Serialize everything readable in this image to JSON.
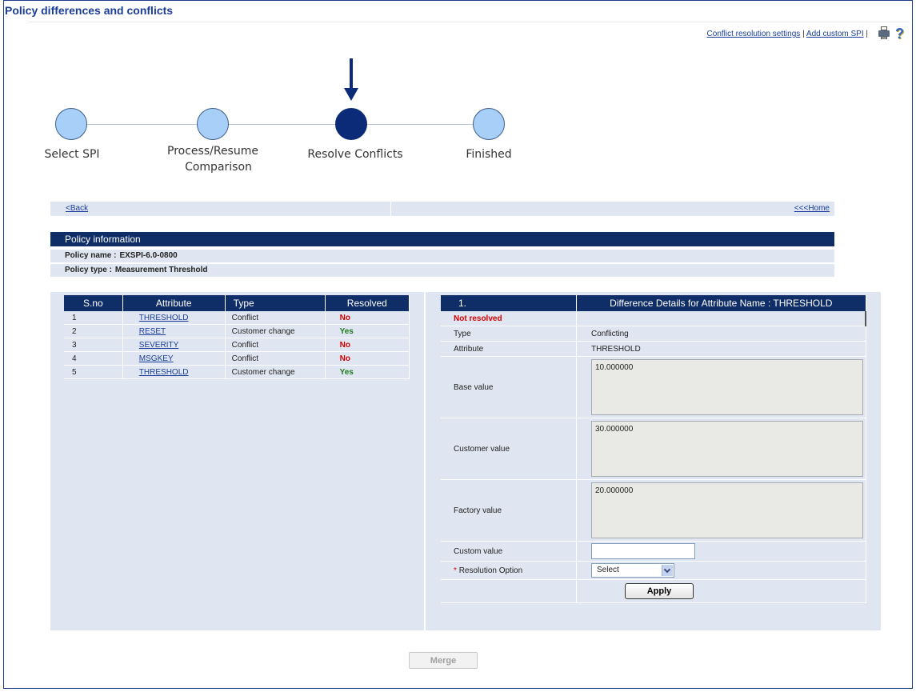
{
  "page": {
    "title": "Policy differences and conflicts"
  },
  "toplinks": {
    "conflict_settings": "Conflict resolution settings",
    "separator": "|",
    "add_custom_spi": "Add custom SPI",
    "separator2": "|"
  },
  "icons": {
    "print": "printer-icon",
    "help": "help-icon"
  },
  "wizard": {
    "current_step": 3,
    "steps": [
      {
        "line1": "Select SPI",
        "line2": ""
      },
      {
        "line1": "Process/Resume",
        "line2": "Comparison"
      },
      {
        "line1": "Resolve Conflicts",
        "line2": ""
      },
      {
        "line1": "Finished",
        "line2": ""
      }
    ]
  },
  "nav": {
    "back": "<Back",
    "home": "<<<Home"
  },
  "policy_info": {
    "heading": "Policy information",
    "name_label": "Policy name :",
    "name_value": "EXSPI-6.0-0800",
    "type_label": "Policy type :",
    "type_value": "Measurement Threshold"
  },
  "attributes_table": {
    "headers": [
      "S.no",
      "Attribute",
      "Type",
      "Resolved"
    ],
    "rows": [
      {
        "sno": "1",
        "attribute": "THRESHOLD",
        "type": "Conflict",
        "resolved": "No"
      },
      {
        "sno": "2",
        "attribute": "RESET",
        "type": "Customer change",
        "resolved": "Yes"
      },
      {
        "sno": "3",
        "attribute": "SEVERITY",
        "type": "Conflict",
        "resolved": "No"
      },
      {
        "sno": "4",
        "attribute": "MSGKEY",
        "type": "Conflict",
        "resolved": "No"
      },
      {
        "sno": "5",
        "attribute": "THRESHOLD",
        "type": "Customer change",
        "resolved": "Yes"
      }
    ]
  },
  "details": {
    "index": "1.",
    "header": "Difference Details for Attribute Name : THRESHOLD",
    "status": "Not resolved",
    "type_label": "Type",
    "type_value": "Conflicting",
    "attribute_label": "Attribute",
    "attribute_value": "THRESHOLD",
    "base_label": "Base value",
    "base_value": "10.000000",
    "customer_label": "Customer value",
    "customer_value": "30.000000",
    "factory_label": "Factory value",
    "factory_value": "20.000000",
    "custom_label": "Custom value",
    "custom_value": "",
    "required_mark": "*",
    "resolution_label": "Resolution Option",
    "resolution_selected": "Select",
    "apply_label": "Apply"
  },
  "footer": {
    "merge_label": "Merge"
  },
  "colors": {
    "header_navy": "#0f2d66",
    "panel_bg": "#dfe6f1",
    "link_blue": "#1a3d99",
    "no_red": "#d40000",
    "yes_green": "#1e7a1e",
    "active_step": "#0b2a78",
    "inactive_step": "#a8cff7"
  }
}
